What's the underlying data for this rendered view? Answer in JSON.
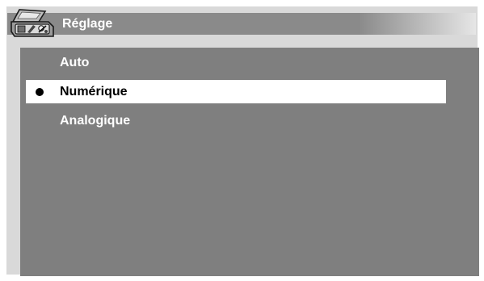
{
  "header": {
    "title": "Réglage",
    "icon": "toolbox-icon"
  },
  "menu": {
    "items": [
      {
        "label": "Auto",
        "selected": false
      },
      {
        "label": "Numérique",
        "selected": true
      },
      {
        "label": "Analogique",
        "selected": false
      }
    ]
  },
  "colors": {
    "panel": "#7f7f7f",
    "title_bar": "#8a8a8a",
    "highlight": "#ffffff",
    "text": "#ffffff",
    "selected_text": "#000000"
  }
}
